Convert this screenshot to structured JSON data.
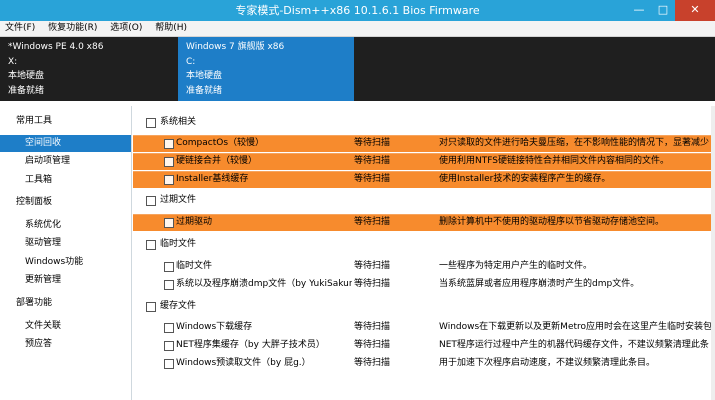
{
  "window": {
    "title": "专家模式-Dism++x86 10.1.6.1 Bios Firmware",
    "min_icon": "minimize-icon",
    "max_icon": "maximize-icon",
    "close_icon": "close-icon"
  },
  "menu": [
    {
      "label": "文件(F)"
    },
    {
      "label": "恢复功能(R)"
    },
    {
      "label": "选项(O)"
    },
    {
      "label": "帮助(H)"
    }
  ],
  "systems": [
    {
      "name": "*Windows PE 4.0 x86",
      "drive": "X:",
      "type": "本地硬盘",
      "status": "准备就绪"
    },
    {
      "name": "Windows 7 旗舰版 x86",
      "drive": "C:",
      "type": "本地硬盘",
      "status": "准备就绪"
    }
  ],
  "sidebar": {
    "sections": [
      {
        "label": "常用工具",
        "items": [
          {
            "label": "空间回收"
          },
          {
            "label": "启动项管理"
          },
          {
            "label": "工具箱"
          }
        ]
      },
      {
        "label": "控制面板",
        "items": [
          {
            "label": "系统优化"
          },
          {
            "label": "驱动管理"
          },
          {
            "label": "Windows功能"
          },
          {
            "label": "更新管理"
          }
        ]
      },
      {
        "label": "部署功能",
        "items": [
          {
            "label": "文件关联"
          },
          {
            "label": "预应答"
          }
        ]
      }
    ]
  },
  "groups": [
    {
      "label": "系统相关",
      "items": [
        {
          "name": "CompactOs（较慢）",
          "status": "等待扫描",
          "desc": "对只读取的文件进行哈夫曼压缩，在不影响性能的情况下，显著减少"
        },
        {
          "name": "硬链接合并（较慢）",
          "status": "等待扫描",
          "desc": "使用利用NTFS硬链接特性合并相同文件内容相同的文件。"
        },
        {
          "name": "Installer基线缓存",
          "status": "等待扫描",
          "desc": "使用Installer技术的安装程序产生的缓存。"
        }
      ]
    },
    {
      "label": "过期文件",
      "items": [
        {
          "name": "过期驱动",
          "status": "等待扫描",
          "desc": "删除计算机中不使用的驱动程序以节省驱动存储池空间。"
        }
      ]
    },
    {
      "label": "临时文件",
      "items": [
        {
          "name": "临时文件",
          "status": "等待扫描",
          "desc": "一些程序为特定用户产生的临时文件。"
        },
        {
          "name": "系统以及程序崩溃dmp文件（by YukiSakura）",
          "status": "等待扫描",
          "desc": "当系统蓝屏或者应用程序崩溃时产生的dmp文件。"
        }
      ]
    },
    {
      "label": "缓存文件",
      "items": [
        {
          "name": "Windows下载缓存",
          "status": "等待扫描",
          "desc": "Windows在下载更新以及更新Metro应用时会在这里产生临时安装包。"
        },
        {
          "name": "NET程序集缓存（by 大胖子技术员）",
          "status": "等待扫描",
          "desc": "NET程序运行过程中产生的机器代码缓存文件，不建议频繁清理此条"
        },
        {
          "name": "Windows预读取文件（by 屁g.）",
          "status": "等待扫描",
          "desc": "用于加速下次程序启动速度，不建议频繁清理此条目。"
        }
      ]
    }
  ],
  "colors": {
    "titlebar": "#29a3d8",
    "selected": "#1e7ec8",
    "highlight": "#f78b2d",
    "sysbar": "#1f1f1f",
    "close": "#c8412c"
  }
}
